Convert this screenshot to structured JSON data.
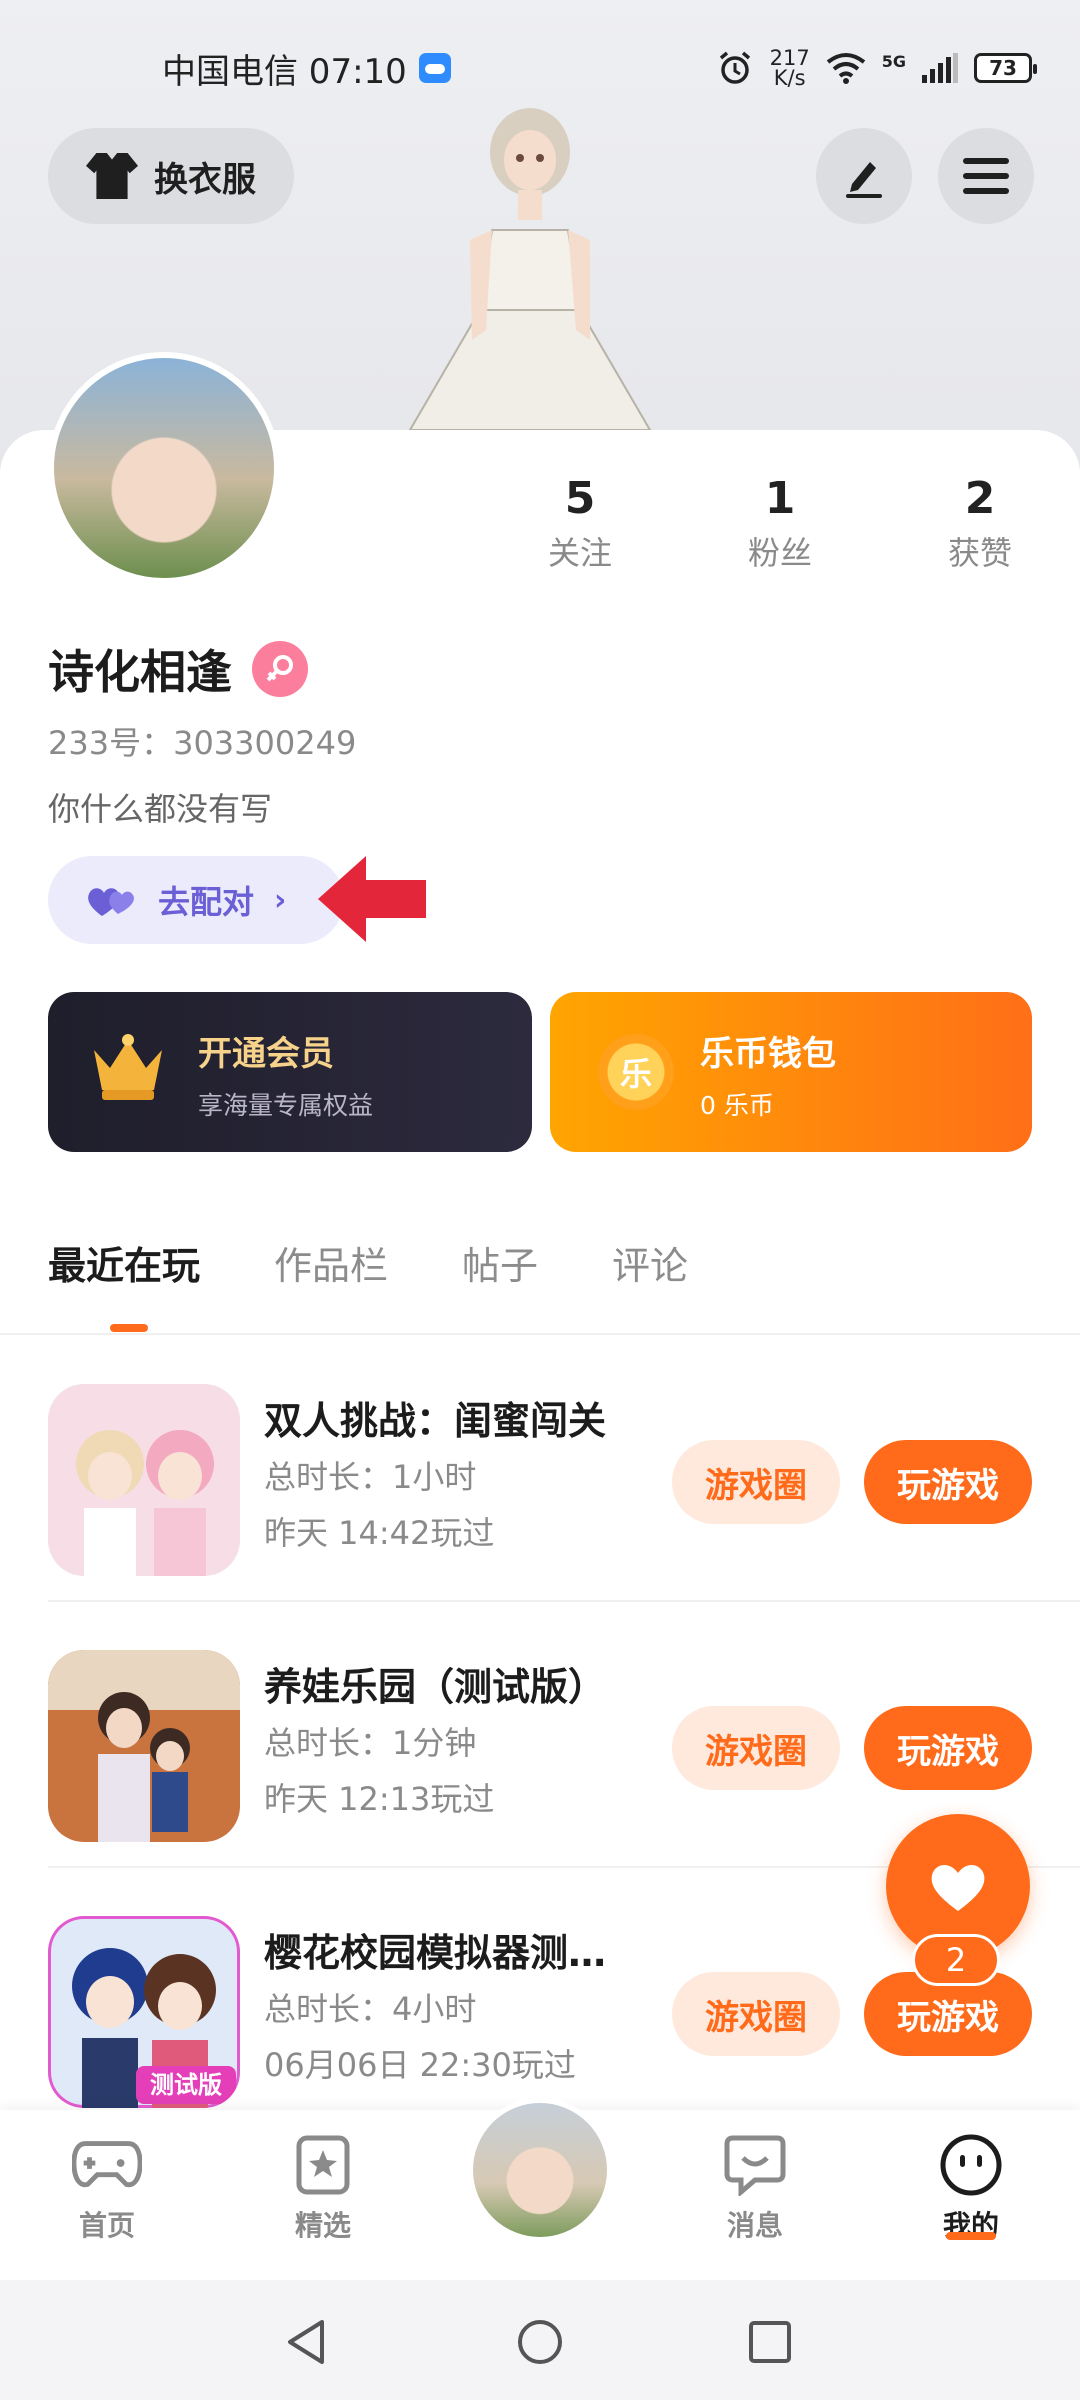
{
  "status_bar": {
    "carrier_time": "中国电信 07:10",
    "net_speed_value": "217",
    "net_speed_unit": "K/s",
    "network": "5G",
    "battery": "73"
  },
  "header": {
    "outfit_label": "换衣服"
  },
  "profile": {
    "username": "诗化相逢",
    "uid": "233号：303300249",
    "bio": "你什么都没有写",
    "match_label": "去配对",
    "stats": [
      {
        "value": "5",
        "label": "关注"
      },
      {
        "value": "1",
        "label": "粉丝"
      },
      {
        "value": "2",
        "label": "获赞"
      }
    ]
  },
  "cards": {
    "vip_title": "开通会员",
    "vip_sub": "享海量专属权益",
    "wallet_title": "乐币钱包",
    "wallet_sub": "0 乐币",
    "coin_char": "乐"
  },
  "tabs": [
    "最近在玩",
    "作品栏",
    "帖子",
    "评论"
  ],
  "games": [
    {
      "name": "双人挑战：闺蜜闯关",
      "duration": "总时长：1小时",
      "last_played": "昨天 14:42玩过",
      "circle_label": "游戏圈",
      "play_label": "玩游戏"
    },
    {
      "name": "养娃乐园（测试版）",
      "duration": "总时长：1分钟",
      "last_played": "昨天 12:13玩过",
      "circle_label": "游戏圈",
      "play_label": "玩游戏"
    },
    {
      "name": "樱花校园模拟器测…",
      "duration": "总时长：4小时",
      "last_played": "06月06日 22:30玩过",
      "circle_label": "游戏圈",
      "play_label": "玩游戏",
      "icon_badge": "测试版"
    }
  ],
  "fab": {
    "badge": "2"
  },
  "bottom_nav": [
    {
      "label": "首页"
    },
    {
      "label": "精选"
    },
    {
      "label": "消息"
    },
    {
      "label": "我的"
    }
  ],
  "colors": {
    "accent": "#ff6b1a",
    "match_purple": "#6b5fd6",
    "vip_gold": "#f6d28a"
  }
}
